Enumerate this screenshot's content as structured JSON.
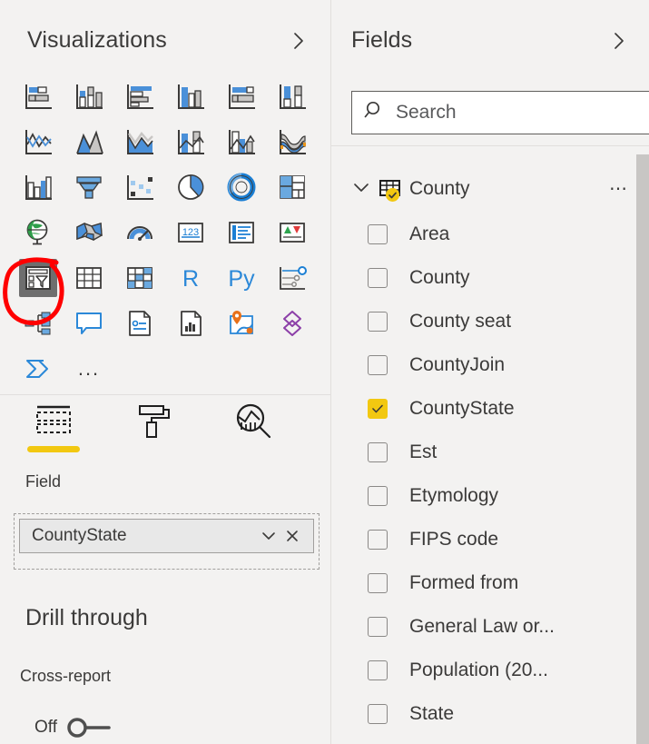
{
  "visualizations": {
    "title": "Visualizations",
    "collapse_icon": "chevron-right-icon",
    "gallery": [
      {
        "id": "stacked-bar-chart",
        "label": "Stacked bar chart"
      },
      {
        "id": "stacked-column-chart",
        "label": "Stacked column chart"
      },
      {
        "id": "clustered-bar-chart",
        "label": "Clustered bar chart"
      },
      {
        "id": "clustered-column-chart",
        "label": "Clustered column chart"
      },
      {
        "id": "hundred-percent-stacked-bar-chart",
        "label": "100% Stacked bar chart"
      },
      {
        "id": "hundred-percent-stacked-column-chart",
        "label": "100% Stacked column chart"
      },
      {
        "id": "line-chart",
        "label": "Line chart"
      },
      {
        "id": "area-chart",
        "label": "Area chart"
      },
      {
        "id": "stacked-area-chart",
        "label": "Stacked area chart"
      },
      {
        "id": "line-and-stacked-column-chart",
        "label": "Line and stacked column chart"
      },
      {
        "id": "line-and-clustered-column-chart",
        "label": "Line and clustered column chart"
      },
      {
        "id": "ribbon-chart",
        "label": "Ribbon chart"
      },
      {
        "id": "waterfall-chart",
        "label": "Waterfall chart"
      },
      {
        "id": "funnel-chart",
        "label": "Funnel chart"
      },
      {
        "id": "scatter-chart",
        "label": "Scatter chart"
      },
      {
        "id": "pie-chart",
        "label": "Pie chart"
      },
      {
        "id": "donut-chart",
        "label": "Donut chart"
      },
      {
        "id": "treemap",
        "label": "Treemap"
      },
      {
        "id": "map",
        "label": "Map"
      },
      {
        "id": "filled-map",
        "label": "Filled map"
      },
      {
        "id": "gauge",
        "label": "Gauge"
      },
      {
        "id": "card",
        "label": "Card"
      },
      {
        "id": "multi-row-card",
        "label": "Multi-row card"
      },
      {
        "id": "kpi",
        "label": "KPI"
      },
      {
        "id": "slicer",
        "label": "Slicer"
      },
      {
        "id": "table",
        "label": "Table"
      },
      {
        "id": "matrix",
        "label": "Matrix"
      },
      {
        "id": "r-script-visual",
        "label": "R script visual"
      },
      {
        "id": "python-visual",
        "label": "Py"
      },
      {
        "id": "key-influencers",
        "label": "Key influencers"
      },
      {
        "id": "decomposition-tree",
        "label": "Decomposition tree"
      },
      {
        "id": "q-and-a",
        "label": "Q&A"
      },
      {
        "id": "smart-narrative",
        "label": "Smart narrative"
      },
      {
        "id": "paginated-report",
        "label": "Paginated report"
      },
      {
        "id": "azure-map",
        "label": "Azure map"
      },
      {
        "id": "power-apps",
        "label": "Power Apps for Power BI"
      },
      {
        "id": "power-automate",
        "label": "Power Automate for Power BI"
      },
      {
        "id": "get-more-visuals",
        "label": "..."
      }
    ],
    "selected_visual": "slicer",
    "annotation": {
      "shape": "hand-drawn-circle",
      "color": "#ff0000",
      "target": "slicer"
    }
  },
  "format_tabs": {
    "items": [
      {
        "id": "fields",
        "icon": "fields-build-icon",
        "active": true
      },
      {
        "id": "format",
        "icon": "paint-roller-icon",
        "active": false
      },
      {
        "id": "analytics",
        "icon": "analytics-magnifier-icon",
        "active": false
      }
    ],
    "accent_color": "#f2c811"
  },
  "field_well": {
    "label": "Field",
    "chip": {
      "name": "CountyState",
      "dropdown_icon": "chevron-down-icon",
      "remove_icon": "close-icon"
    }
  },
  "drill_through": {
    "title": "Drill through",
    "cross_report_label": "Cross-report",
    "toggle_state": "Off"
  },
  "fields": {
    "title": "Fields",
    "collapse_icon": "chevron-right-icon",
    "search": {
      "placeholder": "Search",
      "value": "",
      "icon": "search-icon"
    },
    "table": {
      "name": "County",
      "expanded": true,
      "expand_icon": "chevron-down-icon",
      "table_icon": "table-icon",
      "badge": "checkmark-badge",
      "menu_icon": "ellipsis-icon"
    },
    "items": [
      {
        "name": "Area",
        "checked": false
      },
      {
        "name": "County",
        "checked": false
      },
      {
        "name": "County seat",
        "checked": false
      },
      {
        "name": "CountyJoin",
        "checked": false
      },
      {
        "name": "CountyState",
        "checked": true
      },
      {
        "name": "Est",
        "checked": false
      },
      {
        "name": "Etymology",
        "checked": false
      },
      {
        "name": "FIPS code",
        "checked": false
      },
      {
        "name": "Formed from",
        "checked": false
      },
      {
        "name": "General Law or...",
        "checked": false
      },
      {
        "name": "Population (20...",
        "checked": false
      },
      {
        "name": "State",
        "checked": false
      }
    ]
  },
  "colors": {
    "pane_background": "#f3f2f1",
    "accent_yellow": "#f2c811",
    "text": "#3b3a39",
    "icon_blue": "#4a90d9",
    "annotation_red": "#ff0000",
    "scrollbar": "#c8c6c4"
  }
}
